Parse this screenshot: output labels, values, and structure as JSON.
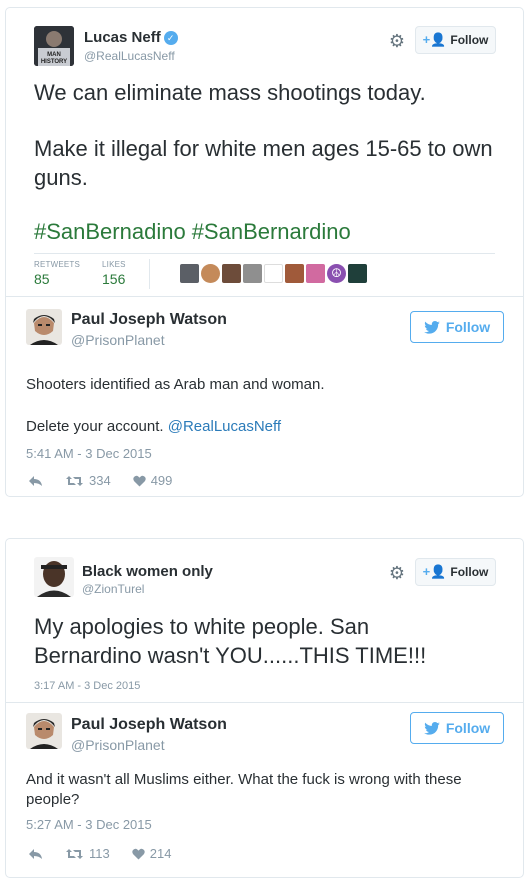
{
  "tweet1": {
    "name": "Lucas Neff",
    "handle": "@RealLucasNeff",
    "follow_label": "Follow",
    "line1": "We can eliminate mass shootings today.",
    "line2": "Make it illegal for white men ages 15-65 to own guns.",
    "hashtags": [
      "#SanBernadino",
      "#SanBernardino"
    ],
    "retweets_label": "RETWEETS",
    "retweets": "85",
    "likes_label": "LIKES",
    "likes": "156",
    "avatar_text": "MAN HISTORY"
  },
  "reply1": {
    "name": "Paul Joseph Watson",
    "handle": "@PrisonPlanet",
    "follow_label": "Follow",
    "text1": "Shooters identified as Arab man and woman.",
    "text2_prefix": "Delete your account. ",
    "text2_mention": "@RealLucasNeff",
    "timestamp": "5:41 AM - 3 Dec 2015",
    "retweets": "334",
    "likes": "499"
  },
  "tweet2": {
    "name": "Black women only",
    "handle": "@ZionTurel",
    "follow_label": "Follow",
    "text": "My apologies to white people. San Bernardino wasn't YOU......THIS TIME!!!",
    "timestamp": "3:17 AM - 3 Dec 2015"
  },
  "reply2": {
    "name": "Paul Joseph Watson",
    "handle": "@PrisonPlanet",
    "follow_label": "Follow",
    "text": "And it wasn't all Muslims either. What the fuck is wrong with these people?",
    "timestamp": "5:27 AM - 3 Dec 2015",
    "retweets": "113",
    "likes": "214"
  },
  "colors": {
    "twitter_blue": "#55acee",
    "hashtag_green": "#2b7a3b",
    "muted": "#8899a6",
    "text": "#292f33",
    "border": "#e1e8ed"
  },
  "icons": [
    "verified-badge-icon",
    "gear-icon",
    "add-user-icon",
    "twitter-bird-icon",
    "reply-icon",
    "retweet-icon",
    "heart-icon"
  ]
}
